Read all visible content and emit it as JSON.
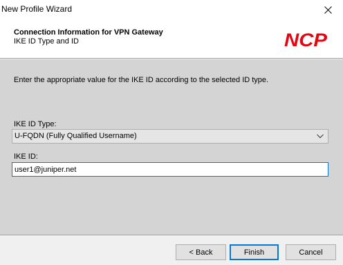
{
  "window": {
    "title": "New Profile Wizard"
  },
  "header": {
    "title": "Connection Information for VPN Gateway",
    "subtitle": "IKE ID Type and ID",
    "logo_text": "NCP",
    "logo_color": "#e30613"
  },
  "body": {
    "instruction": "Enter the appropriate value for the IKE ID according to the selected ID type.",
    "ike_id_type": {
      "label": "IKE ID Type:",
      "selected": "U-FQDN (Fully Qualified Username)"
    },
    "ike_id": {
      "label": "IKE ID:",
      "value": "user1@juniper.net"
    }
  },
  "buttons": {
    "back": "< Back",
    "finish": "Finish",
    "cancel": "Cancel"
  },
  "icons": {
    "close": "close-icon",
    "dropdown": "chevron-down-icon"
  },
  "colors": {
    "accent": "#0078d7",
    "body_bg": "#d4d4d4"
  }
}
